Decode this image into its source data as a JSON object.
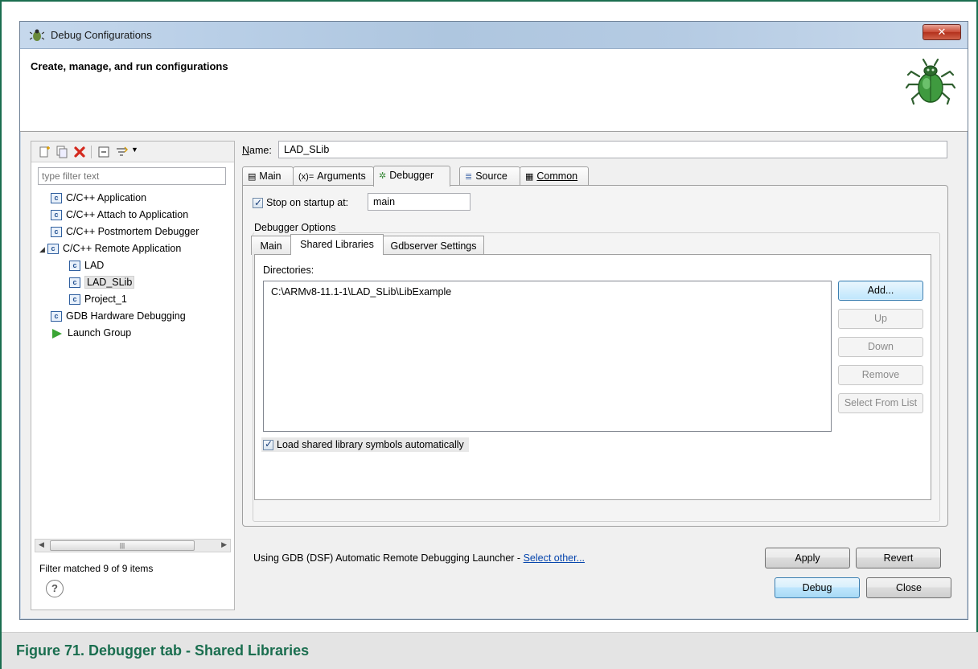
{
  "window": {
    "title": "Debug Configurations",
    "heading": "Create, manage, and run configurations"
  },
  "left_pane": {
    "filter_placeholder": "type filter text",
    "tree": [
      {
        "label": "C/C++ Application",
        "icon": "c-config-icon",
        "level": 0
      },
      {
        "label": "C/C++ Attach to Application",
        "icon": "c-config-icon",
        "level": 0
      },
      {
        "label": "C/C++ Postmortem Debugger",
        "icon": "c-config-icon",
        "level": 0
      },
      {
        "label": "C/C++ Remote Application",
        "icon": "c-config-icon",
        "level": 0,
        "expanded": true
      },
      {
        "label": "LAD",
        "icon": "c-config-icon",
        "level": 1
      },
      {
        "label": "LAD_SLib",
        "icon": "c-config-icon",
        "level": 1,
        "selected": true
      },
      {
        "label": "Project_1",
        "icon": "c-config-icon",
        "level": 1
      },
      {
        "label": "GDB Hardware Debugging",
        "icon": "c-config-icon",
        "level": 0
      },
      {
        "label": "Launch Group",
        "icon": "launch-group-icon",
        "level": 0
      }
    ],
    "filter_status": "Filter matched 9 of 9 items"
  },
  "config": {
    "name_label": "Name:",
    "name_value": "LAD_SLib",
    "tabs": [
      "Main",
      "Arguments",
      "Debugger",
      "Source",
      "Common"
    ],
    "active_tab": "Debugger",
    "stop_on_startup_label": "Stop on startup at:",
    "stop_on_startup_checked": true,
    "stop_on_startup_value": "main",
    "debugger_options_label": "Debugger Options",
    "sub_tabs": [
      "Main",
      "Shared Libraries",
      "Gdbserver Settings"
    ],
    "active_sub_tab": "Shared Libraries",
    "directories_label": "Directories:",
    "directories": [
      "C:\\ARMv8-11.1-1\\LAD_SLib\\LibExample"
    ],
    "buttons": {
      "add": "Add...",
      "up": "Up",
      "down": "Down",
      "remove": "Remove",
      "select_from_list": "Select From List"
    },
    "load_symbols_label": "Load shared library symbols automatically",
    "load_symbols_checked": true,
    "launcher_text": "Using GDB (DSF) Automatic Remote Debugging Launcher - ",
    "launcher_link": "Select other...",
    "apply": "Apply",
    "revert": "Revert"
  },
  "footer": {
    "debug": "Debug",
    "close": "Close"
  },
  "caption": "Figure 71. Debugger tab - Shared Libraries",
  "colors": {
    "caption_text": "#1a6e4f",
    "frame_border": "#1a6e4f",
    "link": "#0645ad"
  }
}
